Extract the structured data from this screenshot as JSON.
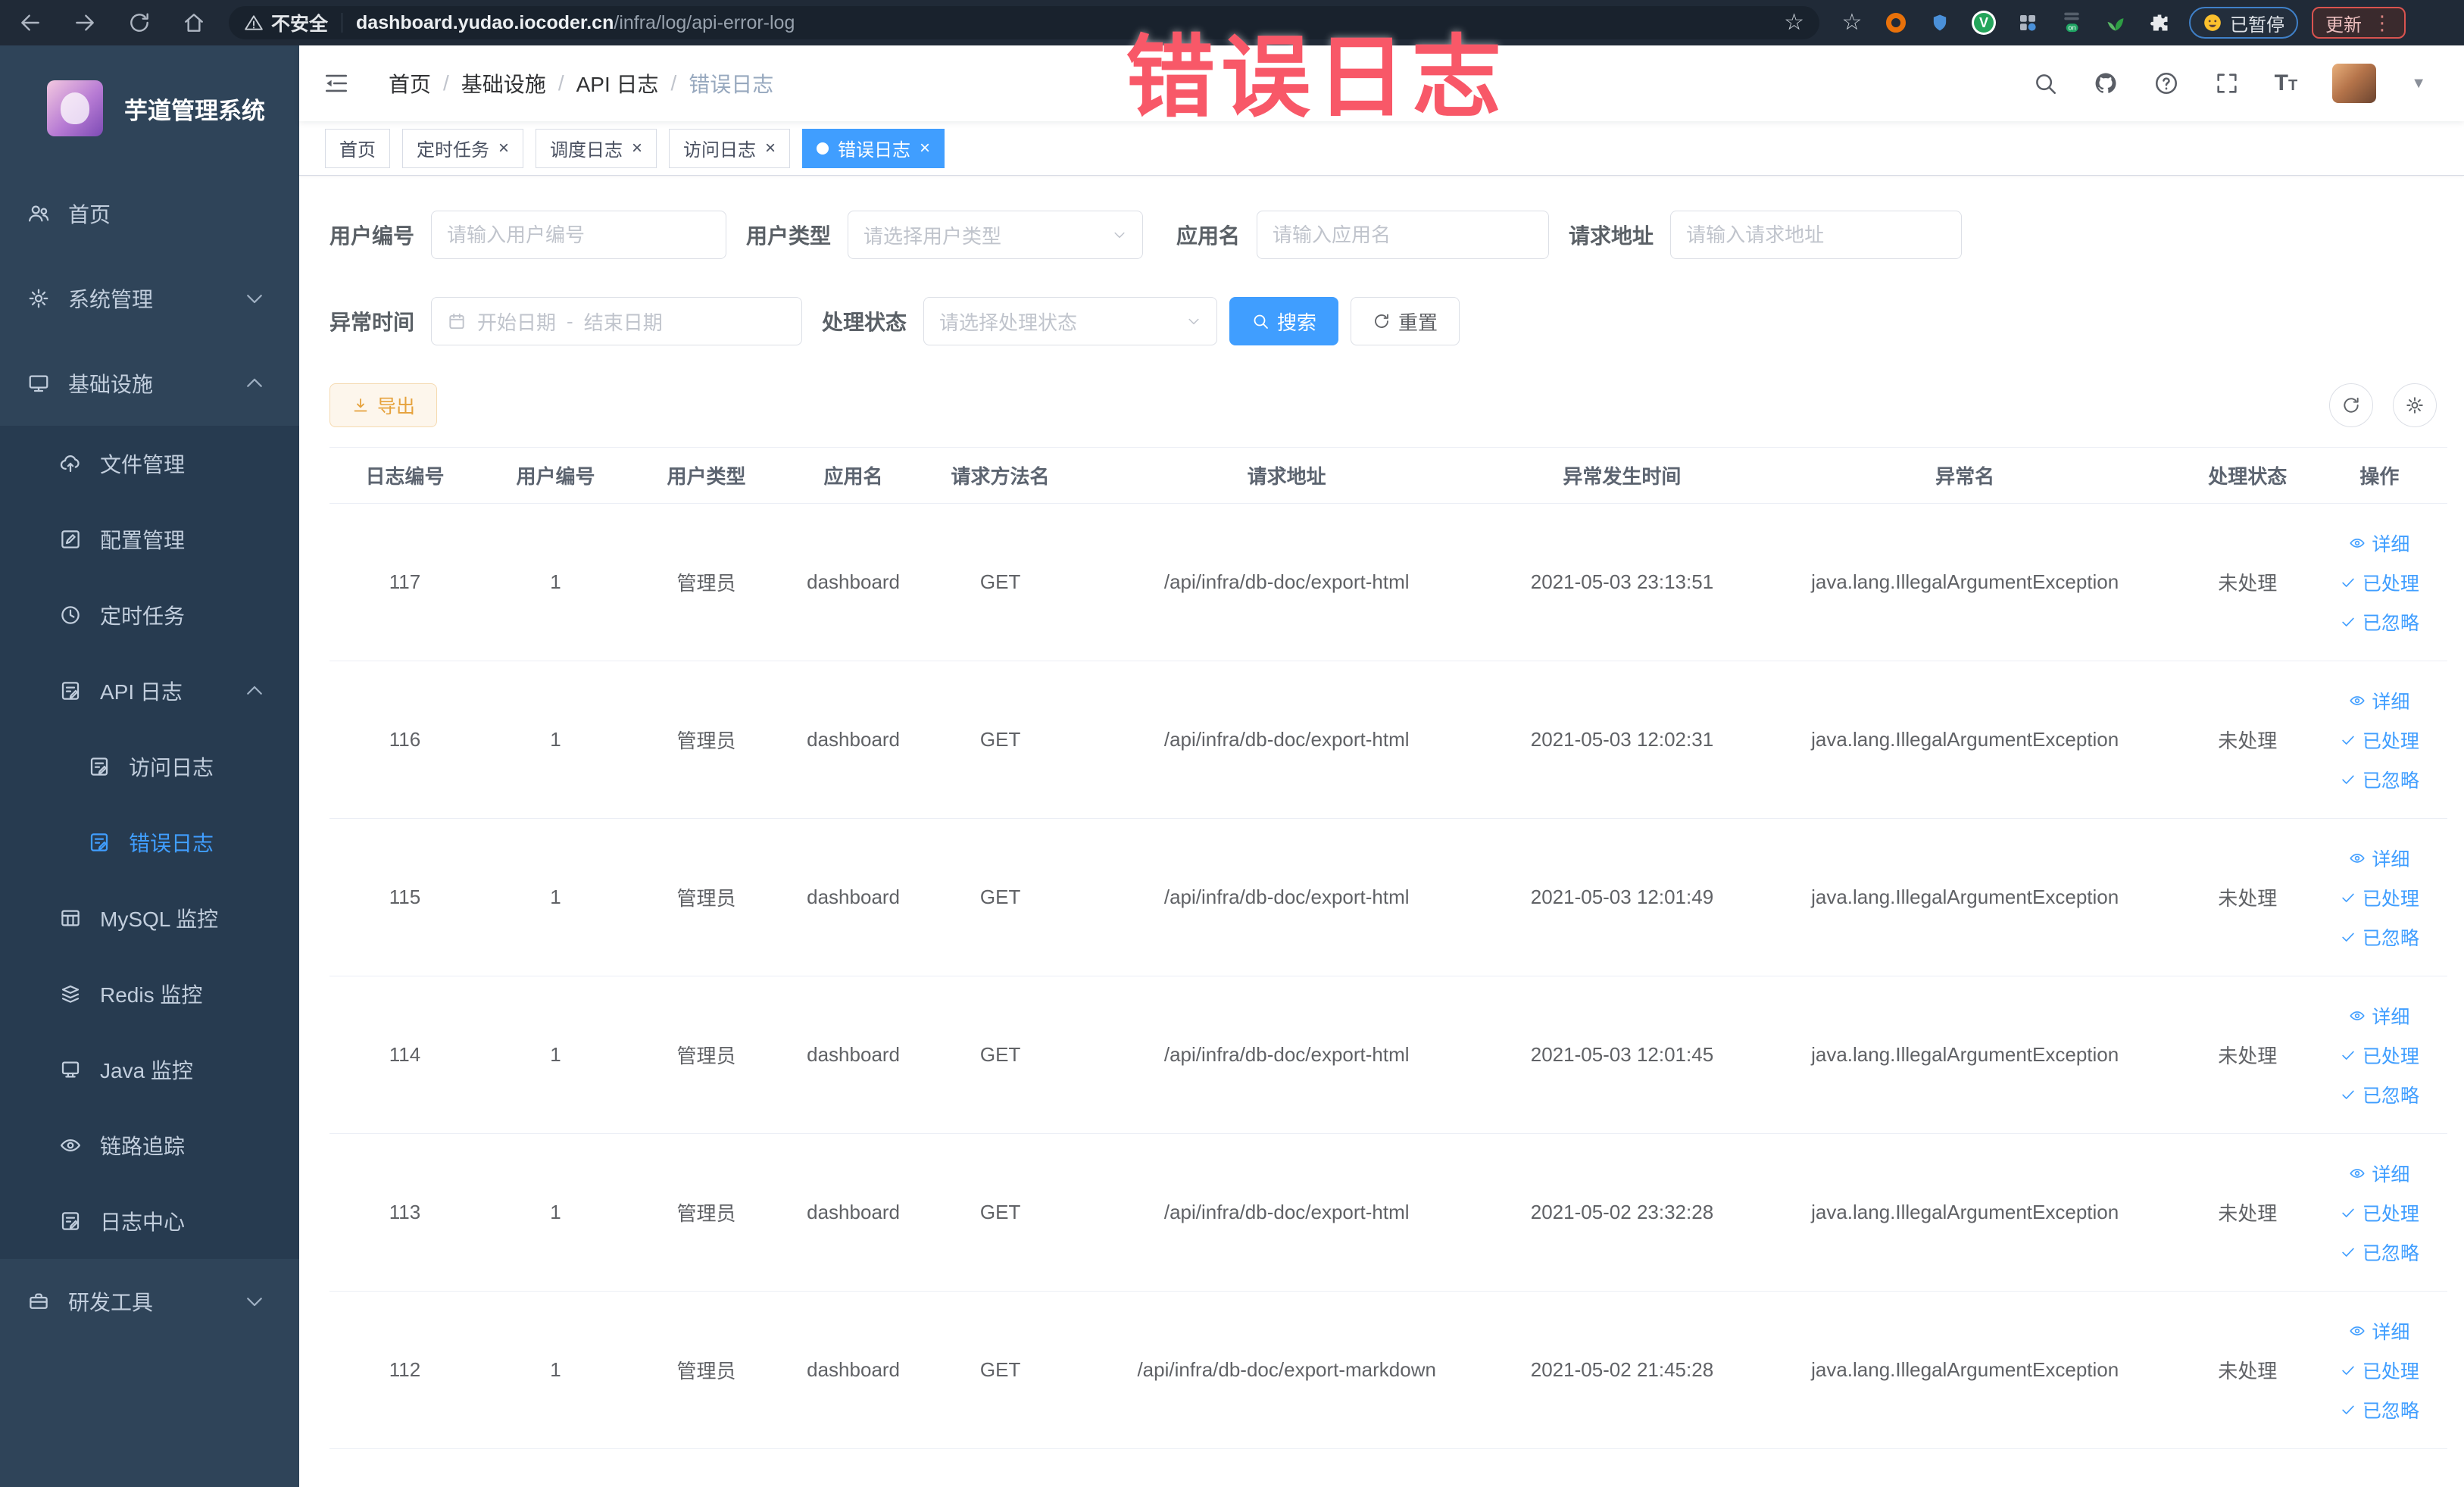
{
  "colors": {
    "primary": "#409EFF",
    "sidebar_bg": "#2F4459",
    "submenu_bg": "#273B50",
    "active_tab_bg": "#409EFF",
    "annotation_red": "#F85868",
    "warning_button": "#E6A23C"
  },
  "annotation": {
    "title": "错误日志"
  },
  "browser": {
    "nav_icons": [
      "back-icon",
      "forward-icon",
      "reload-icon",
      "home-icon"
    ],
    "security_label": "不安全",
    "url_host": "dashboard.yudao.iocoder.cn",
    "url_path": "/infra/log/api-error-log",
    "extensions": [
      "bookmark-star-icon",
      "orange-extension-icon",
      "shield-extension-icon",
      "green-v-extension-icon",
      "grid-extension-icon",
      "on-badge-extension-icon",
      "leaf-extension-icon",
      "puzzle-extension-icon"
    ],
    "paused_badge": "已暂停",
    "update_button": "更新"
  },
  "sidebar": {
    "app_title": "芋道管理系统",
    "items": [
      {
        "label": "首页",
        "icon": "users-icon",
        "level": 0
      },
      {
        "label": "系统管理",
        "icon": "gear-icon",
        "level": 0,
        "arrow": "down"
      },
      {
        "label": "基础设施",
        "icon": "monitor-icon",
        "level": 0,
        "arrow": "up"
      },
      {
        "label": "文件管理",
        "icon": "cloud-icon",
        "level": 1
      },
      {
        "label": "配置管理",
        "icon": "edit-icon",
        "level": 1
      },
      {
        "label": "定时任务",
        "icon": "clock-icon",
        "level": 1
      },
      {
        "label": "API 日志",
        "icon": "doc-log-icon",
        "level": 1,
        "arrow": "up"
      },
      {
        "label": "访问日志",
        "icon": "doc-log-icon",
        "level": 2
      },
      {
        "label": "错误日志",
        "icon": "doc-log-icon",
        "level": 2,
        "active": true
      },
      {
        "label": "MySQL 监控",
        "icon": "table-icon",
        "level": 1
      },
      {
        "label": "Redis 监控",
        "icon": "stack-icon",
        "level": 1
      },
      {
        "label": "Java 监控",
        "icon": "java-icon",
        "level": 1
      },
      {
        "label": "链路追踪",
        "icon": "eye-icon",
        "level": 1
      },
      {
        "label": "日志中心",
        "icon": "doc-log-icon",
        "level": 1
      },
      {
        "label": "研发工具",
        "icon": "toolbox-icon",
        "level": 0,
        "arrow": "down"
      }
    ]
  },
  "header": {
    "breadcrumb": [
      "首页",
      "基础设施",
      "API 日志",
      "错误日志"
    ],
    "right_icons": [
      "search-icon",
      "github-icon",
      "help-icon",
      "fullscreen-icon",
      "font-size-icon"
    ]
  },
  "tabs": [
    {
      "label": "首页",
      "closable": false,
      "active": false
    },
    {
      "label": "定时任务",
      "closable": true,
      "active": false
    },
    {
      "label": "调度日志",
      "closable": true,
      "active": false
    },
    {
      "label": "访问日志",
      "closable": true,
      "active": false
    },
    {
      "label": "错误日志",
      "closable": true,
      "active": true
    }
  ],
  "filters": {
    "user_id": {
      "label": "用户编号",
      "placeholder": "请输入用户编号"
    },
    "user_type": {
      "label": "用户类型",
      "placeholder": "请选择用户类型"
    },
    "app_name": {
      "label": "应用名",
      "placeholder": "请输入应用名"
    },
    "request_url": {
      "label": "请求地址",
      "placeholder": "请输入请求地址"
    },
    "exception_time": {
      "label": "异常时间",
      "start_placeholder": "开始日期",
      "separator": "-",
      "end_placeholder": "结束日期"
    },
    "process_status": {
      "label": "处理状态",
      "placeholder": "请选择处理状态"
    },
    "search_button": "搜索",
    "reset_button": "重置"
  },
  "toolbar": {
    "export_label": "导出"
  },
  "table": {
    "headers": [
      "日志编号",
      "用户编号",
      "用户类型",
      "应用名",
      "请求方法名",
      "请求地址",
      "异常发生时间",
      "异常名",
      "处理状态",
      "操作"
    ],
    "action_labels": [
      "详细",
      "已处理",
      "已忽略"
    ],
    "rows": [
      {
        "id": "117",
        "user_id": "1",
        "user_type": "管理员",
        "app": "dashboard",
        "method": "GET",
        "url": "/api/infra/db-doc/export-html",
        "time": "2021-05-03 23:13:51",
        "exception": "java.lang.IllegalArgumentException",
        "status": "未处理"
      },
      {
        "id": "116",
        "user_id": "1",
        "user_type": "管理员",
        "app": "dashboard",
        "method": "GET",
        "url": "/api/infra/db-doc/export-html",
        "time": "2021-05-03 12:02:31",
        "exception": "java.lang.IllegalArgumentException",
        "status": "未处理"
      },
      {
        "id": "115",
        "user_id": "1",
        "user_type": "管理员",
        "app": "dashboard",
        "method": "GET",
        "url": "/api/infra/db-doc/export-html",
        "time": "2021-05-03 12:01:49",
        "exception": "java.lang.IllegalArgumentException",
        "status": "未处理"
      },
      {
        "id": "114",
        "user_id": "1",
        "user_type": "管理员",
        "app": "dashboard",
        "method": "GET",
        "url": "/api/infra/db-doc/export-html",
        "time": "2021-05-03 12:01:45",
        "exception": "java.lang.IllegalArgumentException",
        "status": "未处理"
      },
      {
        "id": "113",
        "user_id": "1",
        "user_type": "管理员",
        "app": "dashboard",
        "method": "GET",
        "url": "/api/infra/db-doc/export-html",
        "time": "2021-05-02 23:32:28",
        "exception": "java.lang.IllegalArgumentException",
        "status": "未处理"
      },
      {
        "id": "112",
        "user_id": "1",
        "user_type": "管理员",
        "app": "dashboard",
        "method": "GET",
        "url": "/api/infra/db-doc/export-markdown",
        "time": "2021-05-02 21:45:28",
        "exception": "java.lang.IllegalArgumentException",
        "status": "未处理"
      }
    ]
  }
}
